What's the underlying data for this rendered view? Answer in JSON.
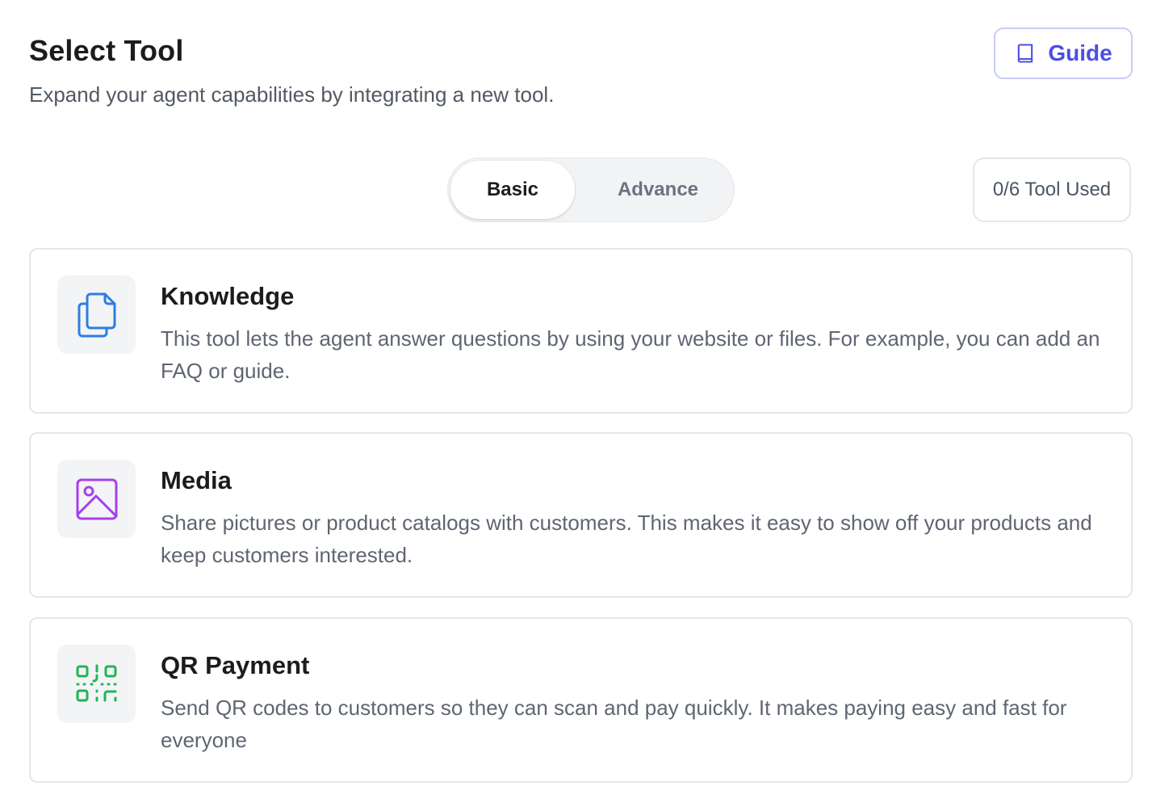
{
  "header": {
    "title": "Select Tool",
    "subtitle": "Expand your agent capabilities by integrating a new tool.",
    "guide_label": "Guide"
  },
  "tabs": [
    {
      "label": "Basic",
      "active": true
    },
    {
      "label": "Advance",
      "active": false
    }
  ],
  "usage": {
    "label": "0/6 Tool Used"
  },
  "tools": [
    {
      "title": "Knowledge",
      "description": "This tool lets the agent answer questions by using your website or files. For example, you can add an FAQ or guide.",
      "icon": "document-copy-icon",
      "icon_color": "#2f7de1"
    },
    {
      "title": "Media",
      "description": "Share pictures or product catalogs with customers. This makes it easy to show off your products and keep customers interested.",
      "icon": "image-icon",
      "icon_color": "#a63ff0"
    },
    {
      "title": "QR Payment",
      "description": "Send QR codes to customers so they can scan and pay quickly. It makes paying easy and fast for everyone",
      "icon": "qr-code-icon",
      "icon_color": "#22b455"
    }
  ],
  "colors": {
    "accent": "#4b4ee6",
    "accent_border": "#c9cdf7"
  }
}
